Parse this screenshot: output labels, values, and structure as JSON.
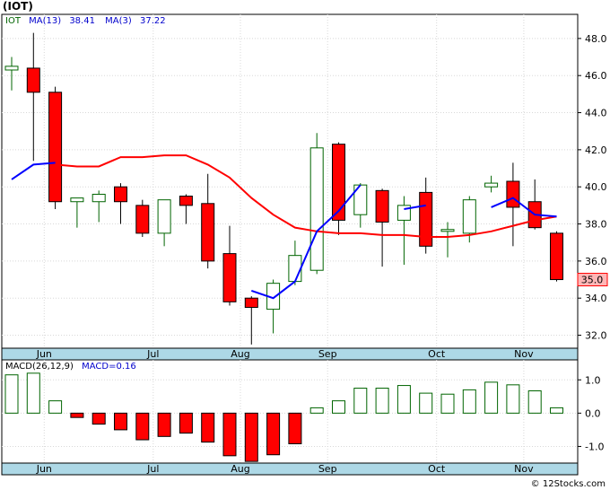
{
  "header": {
    "title": "(IOT)",
    "legend": {
      "symbol": "IOT",
      "ma13_label": "MA(13)",
      "ma13_value": "38.41",
      "ma3_label": "MA(3)",
      "ma3_value": "37.22"
    },
    "last_price_tag": "35.0",
    "macd_label": "MACD(26,12,9)",
    "macd_value_label": "MACD=0.16",
    "watermark": "© 12Stocks.com"
  },
  "colors": {
    "up_candle_border": "#006400",
    "down_candle_fill": "#ff0000",
    "ma13": "#ff0000",
    "ma3": "#0000ff",
    "grid": "#d8d8d8",
    "axis_bg": "#add8e6",
    "price_tag_bg": "#ffb6b6",
    "macd_bar": "#006400",
    "macd_neg_fill": "#ff0000"
  },
  "chart_data": [
    {
      "type": "candlestick",
      "title": "(IOT)",
      "ylim": [
        31.3,
        49.3
      ],
      "yticks": [
        32.0,
        34.0,
        36.0,
        38.0,
        40.0,
        42.0,
        44.0,
        46.0,
        48.0
      ],
      "xticks": [
        {
          "label": "Jun",
          "index": 1
        },
        {
          "label": "Jul",
          "index": 6
        },
        {
          "label": "Aug",
          "index": 10
        },
        {
          "label": "Sep",
          "index": 14
        },
        {
          "label": "Oct",
          "index": 19
        },
        {
          "label": "Nov",
          "index": 23
        }
      ],
      "candles": [
        {
          "open": 46.3,
          "high": 47.0,
          "low": 45.2,
          "close": 46.5
        },
        {
          "open": 46.4,
          "high": 48.3,
          "low": 41.4,
          "close": 45.1
        },
        {
          "open": 45.1,
          "high": 45.4,
          "low": 38.8,
          "close": 39.2
        },
        {
          "open": 39.2,
          "high": 39.4,
          "low": 37.8,
          "close": 39.4
        },
        {
          "open": 39.2,
          "high": 39.8,
          "low": 38.1,
          "close": 39.6
        },
        {
          "open": 40.0,
          "high": 40.2,
          "low": 38.0,
          "close": 39.2
        },
        {
          "open": 39.0,
          "high": 39.3,
          "low": 37.3,
          "close": 37.5
        },
        {
          "open": 37.5,
          "high": 39.2,
          "low": 36.8,
          "close": 39.3
        },
        {
          "open": 39.5,
          "high": 39.6,
          "low": 38.0,
          "close": 39.0
        },
        {
          "open": 39.1,
          "high": 40.7,
          "low": 35.6,
          "close": 36.0
        },
        {
          "open": 36.4,
          "high": 37.9,
          "low": 33.6,
          "close": 33.8
        },
        {
          "open": 34.0,
          "high": 34.1,
          "low": 31.5,
          "close": 33.5
        },
        {
          "open": 33.4,
          "high": 35.0,
          "low": 32.1,
          "close": 34.8
        },
        {
          "open": 34.9,
          "high": 37.1,
          "low": 34.7,
          "close": 36.3
        },
        {
          "open": 35.5,
          "high": 42.9,
          "low": 35.3,
          "close": 42.1
        },
        {
          "open": 42.3,
          "high": 42.4,
          "low": 37.4,
          "close": 38.2
        },
        {
          "open": 38.5,
          "high": 40.2,
          "low": 37.8,
          "close": 40.1
        },
        {
          "open": 39.8,
          "high": 39.9,
          "low": 35.7,
          "close": 38.1
        },
        {
          "open": 38.2,
          "high": 39.5,
          "low": 35.8,
          "close": 39.0
        },
        {
          "open": 39.7,
          "high": 40.5,
          "low": 36.4,
          "close": 36.8
        },
        {
          "open": 37.6,
          "high": 38.1,
          "low": 36.2,
          "close": 37.7
        },
        {
          "open": 37.5,
          "high": 39.5,
          "low": 37.0,
          "close": 39.3
        },
        {
          "open": 40.0,
          "high": 40.6,
          "low": 39.7,
          "close": 40.2
        },
        {
          "open": 40.3,
          "high": 41.3,
          "low": 36.8,
          "close": 38.9
        },
        {
          "open": 39.2,
          "high": 40.4,
          "low": 37.7,
          "close": 37.8
        },
        {
          "open": 37.5,
          "high": 37.6,
          "low": 34.9,
          "close": 35.0
        }
      ],
      "ma13": {
        "name": "MA(13)",
        "values": [
          null,
          null,
          41.2,
          41.1,
          41.1,
          41.6,
          41.6,
          41.7,
          41.7,
          41.2,
          40.5,
          39.4,
          38.5,
          37.8,
          37.6,
          37.5,
          37.5,
          37.4,
          37.4,
          37.3,
          37.3,
          37.4,
          37.6,
          37.9,
          38.2,
          38.4
        ]
      },
      "ma3": {
        "name": "MA(3)",
        "values": [
          40.4,
          41.2,
          41.3,
          null,
          null,
          null,
          null,
          null,
          null,
          null,
          null,
          34.4,
          34.0,
          34.9,
          37.6,
          38.7,
          40.1,
          null,
          38.8,
          39.0,
          null,
          null,
          38.9,
          39.4,
          38.5,
          38.4
        ]
      },
      "ma3_segments": [
        [
          0,
          2
        ],
        [
          11,
          16
        ],
        [
          18,
          19
        ],
        [
          22,
          25
        ]
      ]
    },
    {
      "type": "bar",
      "title": "MACD(26,12,9)",
      "ylim": [
        -1.5,
        1.6
      ],
      "yticks": [
        -1.0,
        0.0,
        1.0
      ],
      "xticks": [
        {
          "label": "Jun",
          "index": 1
        },
        {
          "label": "Jul",
          "index": 6
        },
        {
          "label": "Aug",
          "index": 10
        },
        {
          "label": "Sep",
          "index": 14
        },
        {
          "label": "Oct",
          "index": 19
        },
        {
          "label": "Nov",
          "index": 23
        }
      ],
      "values": [
        1.15,
        1.2,
        0.37,
        -0.13,
        -0.33,
        -0.5,
        -0.8,
        -0.7,
        -0.6,
        -0.87,
        -1.28,
        -1.45,
        -1.25,
        -0.92,
        0.16,
        0.37,
        0.75,
        0.75,
        0.83,
        0.6,
        0.57,
        0.7,
        0.93,
        0.85,
        0.67,
        0.16
      ]
    }
  ]
}
